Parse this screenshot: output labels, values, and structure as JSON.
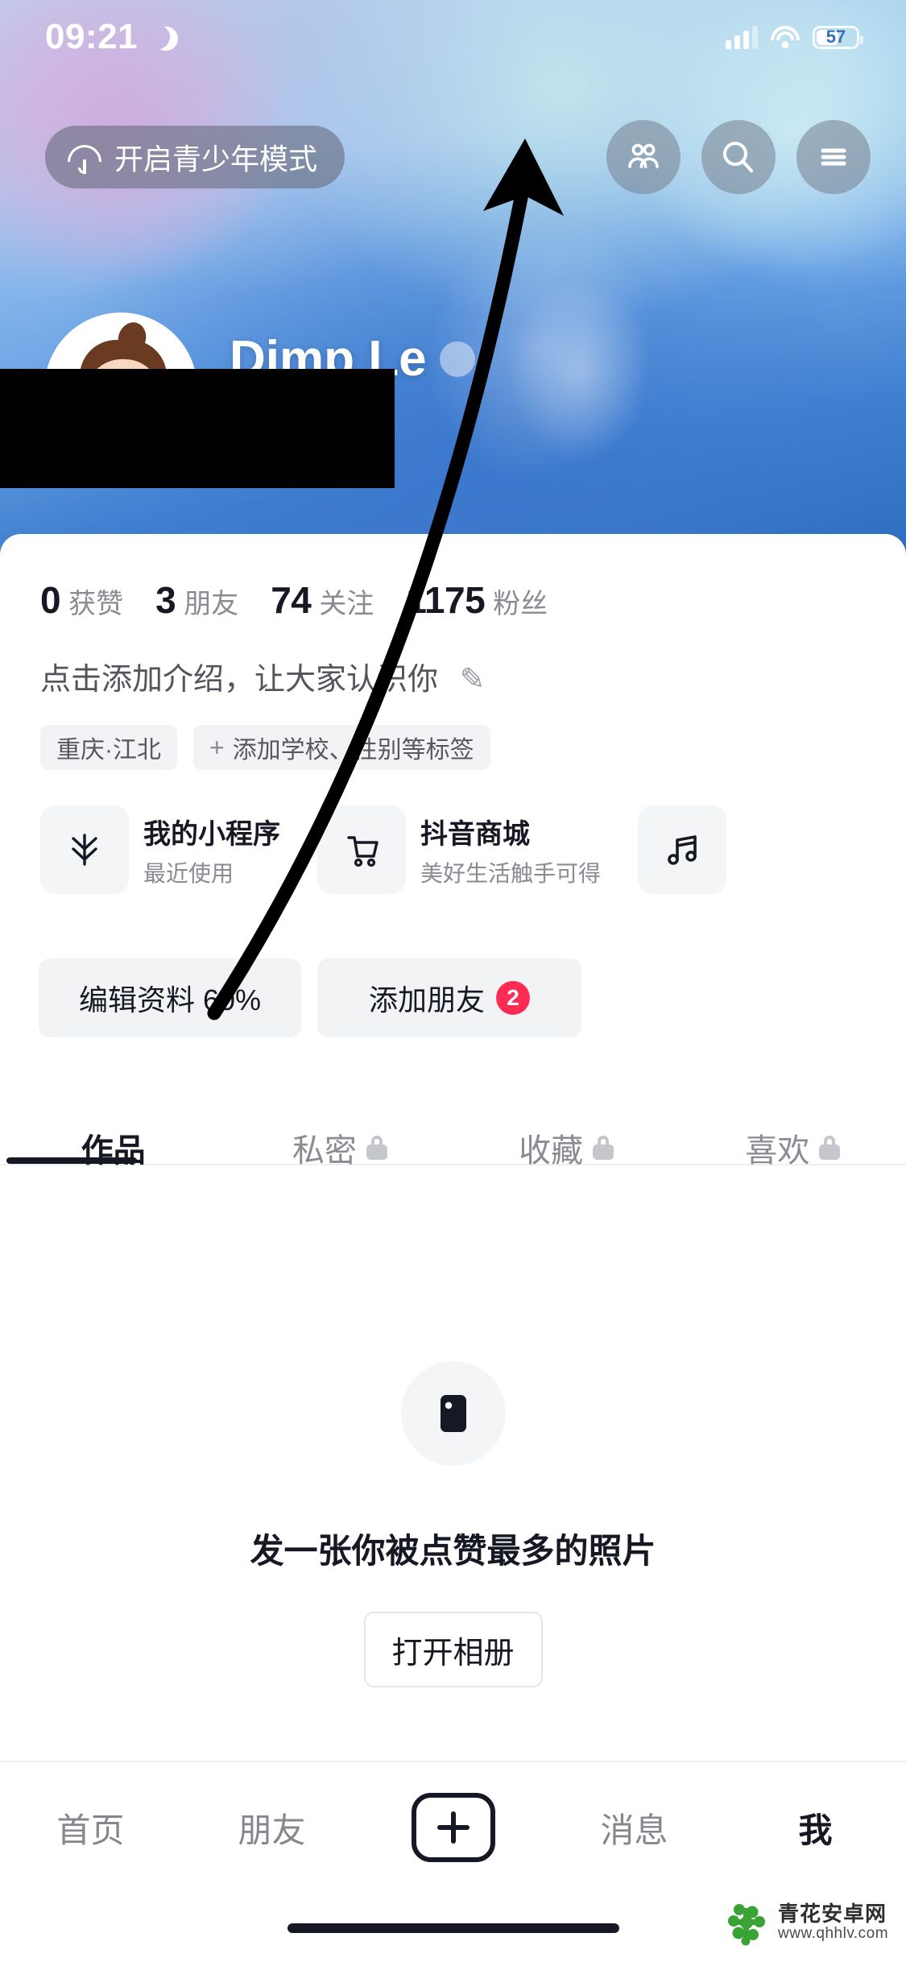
{
  "status_bar": {
    "time": "09:21",
    "moon_icon": "crescent-moon-icon",
    "signal_icon": "cellular-signal-icon",
    "wifi_icon": "wifi-icon",
    "battery_level": "57"
  },
  "header": {
    "teen_mode_label": "开启青少年模式",
    "teen_mode_icon": "umbrella-icon",
    "buttons": [
      {
        "name": "friends-icon",
        "label": "朋友"
      },
      {
        "name": "search-icon",
        "label": "搜索"
      },
      {
        "name": "menu-icon",
        "label": "菜单"
      }
    ]
  },
  "profile": {
    "avatar_alt": "用户头像",
    "display_name": "Dimp Le",
    "stats": [
      {
        "value": "0",
        "label": "获赞"
      },
      {
        "value": "3",
        "label": "朋友"
      },
      {
        "value": "74",
        "label": "关注"
      },
      {
        "value": "1175",
        "label": "粉丝"
      }
    ],
    "bio_placeholder": "点击添加介绍，让大家认识你",
    "bio_edit_icon": "pencil-icon",
    "tags": [
      {
        "text": "重庆·江北",
        "has_plus": false
      },
      {
        "text": "添加学校、性别等标签",
        "has_plus": true
      }
    ]
  },
  "service_cards": [
    {
      "icon": "mini-program-icon",
      "title": "我的小程序",
      "subtitle": "最近使用"
    },
    {
      "icon": "shopping-cart-icon",
      "title": "抖音商城",
      "subtitle": "美好生活触手可得"
    },
    {
      "icon": "music-note-icon",
      "title": "",
      "subtitle": ""
    }
  ],
  "actions": [
    {
      "label": "编辑资料 60%",
      "badge": ""
    },
    {
      "label": "添加朋友",
      "badge": "2"
    }
  ],
  "tabs": [
    {
      "label": "作品",
      "locked": false,
      "active": true
    },
    {
      "label": "私密",
      "locked": true,
      "active": false
    },
    {
      "label": "收藏",
      "locked": true,
      "active": false
    },
    {
      "label": "喜欢",
      "locked": true,
      "active": false
    }
  ],
  "empty_state": {
    "icon": "image-placeholder-icon",
    "message": "发一张你被点赞最多的照片",
    "button_label": "打开相册"
  },
  "bottom_nav": [
    {
      "label": "首页",
      "active": false,
      "type": "text"
    },
    {
      "label": "朋友",
      "active": false,
      "type": "text"
    },
    {
      "label": "+",
      "active": false,
      "type": "plus"
    },
    {
      "label": "消息",
      "active": false,
      "type": "text"
    },
    {
      "label": "我",
      "active": true,
      "type": "text"
    }
  ],
  "watermark": {
    "site_name": "青花安卓网",
    "site_url": "www.qhhlv.com",
    "logo_color": "#3aa335"
  },
  "colors": {
    "accent_red": "#fe2c55",
    "text_primary": "#161823",
    "text_secondary": "#8a8b93",
    "chip_bg": "#f2f3f5"
  }
}
